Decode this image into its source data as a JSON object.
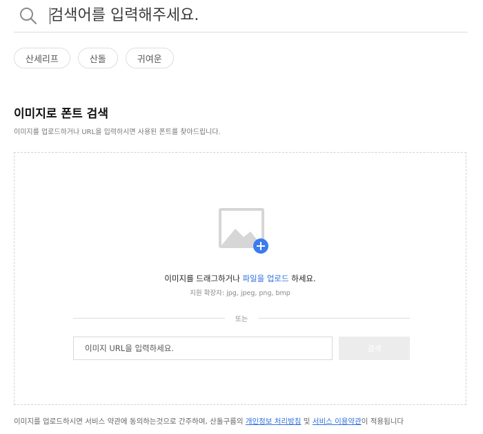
{
  "search": {
    "placeholder": "검색어를 입력해주세요."
  },
  "chips": [
    "산세리프",
    "산돌",
    "귀여운"
  ],
  "section": {
    "title": "이미지로 폰트 검색",
    "description": "이미지를 업로드하거나 URL을 입력하시면 사용된 폰트를 찾아드립니다."
  },
  "dropzone": {
    "text_before": "이미지를 드래그하거나 ",
    "link": "파일을 업로드",
    "text_after": " 하세요.",
    "formats": "지원 확장자: jpg, jpeg, png, bmp",
    "or": "또는",
    "url_placeholder": "이미지 URL을 입력하세요.",
    "search_button": "검색"
  },
  "footer": {
    "before": "이미지를 업로드하시면 서비스 약관에 동의하는것으로 간주하며, 산돌구름의 ",
    "privacy_link": "개인정보 처리방침",
    "middle": " 및 ",
    "terms_link": "서비스 이용약관",
    "after": "이 적용됩니다"
  },
  "colors": {
    "accent": "#2f6fe0",
    "plus_badge": "#3b7bef",
    "icon_gray": "#d6d6d6"
  },
  "icons": {
    "search": "search-icon",
    "image_upload": "image-add-icon"
  }
}
